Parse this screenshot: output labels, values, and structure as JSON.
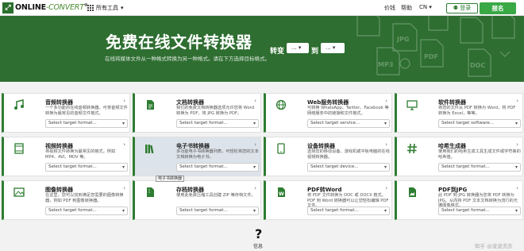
{
  "nav": {
    "logo_mark": "⤢",
    "logo_a": "ONLINE",
    "logo_b": "-CONVERT",
    "logo_c": "®",
    "all_tools": "所有工具",
    "pricing": "价钱",
    "help": "帮助",
    "lang": "CN",
    "login": "登录",
    "signup": "报名"
  },
  "hero": {
    "title": "免费在线文件转换器",
    "subtitle": "在线将媒体文件从一种格式转换为另一种格式。请在下方选择目标格式。",
    "convert_label": "转变",
    "to_label": "到",
    "from_value": "...",
    "to_value": "...",
    "deco_labels": [
      "JPG",
      "PDF",
      "DOC",
      "MP3"
    ]
  },
  "cards": [
    {
      "title": "音频转换器",
      "desc": "一个多功能的在线音频转换器。可将音频文件转换为最常见的音频文件格式。",
      "select": "Select target format...",
      "icon": "music-icon"
    },
    {
      "title": "文档转换器",
      "desc": "我们的免费文档转换器选项允许您将 Word 转换为 PDF、将 JPG 转换为 PDF。",
      "select": "Select target format...",
      "icon": "document-icon"
    },
    {
      "title": "Web服务转换器",
      "desc": "可转换 WhatsApp、Twitter、Facebook 等网络服务中的链接和文件格式。",
      "select": "Select target service...",
      "icon": "globe-icon"
    },
    {
      "title": "软件转换器",
      "desc": "将您的文件从 PDF 转换为 Word，将 PDF 转换为 Excel，等等。",
      "select": "Select target software...",
      "icon": "monitor-icon"
    },
    {
      "title": "视频转换器",
      "desc": "将视频文件转换为最常见的格式，例如 MP4、AVI、MOV 等。",
      "select": "Select target format...",
      "icon": "film-icon"
    },
    {
      "title": "电子书转换器",
      "desc": "多功能电子书转换器列表，可轻松将您的文本文档转换为电子书。",
      "select": "Select target format...",
      "icon": "books-icon"
    },
    {
      "title": "设备转换器",
      "desc": "选择您的移动设备、游戏机或平板电脑的在线视频转换器。",
      "select": "Select target device...",
      "icon": "tablet-icon"
    },
    {
      "title": "哈希生成器",
      "desc": "使用我们的哈希生成工具生成文件或字符串的哈希值。",
      "select": "Select target format...",
      "icon": "hash-icon"
    },
    {
      "title": "图像转换器",
      "desc": "在这里，您可以找到满足您需要的图像转换器，例如 PDF 到图像转换器。",
      "select": "Select target format...",
      "icon": "image-icon"
    },
    {
      "title": "存档转换器",
      "desc": "使用此免费压缩工具创建 ZIP 等存档文件。",
      "select": "Select target format...",
      "icon": "archive-icon"
    },
    {
      "title": "PDF转Word",
      "desc": "将 PDF 文件转换为 DOC 或 DOCX 格式。PDF 到 Word 转换器可以让您轻松编辑 PDF 文件。",
      "select": "Select target format...",
      "icon": "word-icon"
    },
    {
      "title": "PDF到JPG",
      "desc": "此 PDF 到 JPG 转换器为您将 PDF 转换为 JPG。从而将 PDF 文本文档转换为流行的光栅图像格式。",
      "select": "Select target format...",
      "icon": "pdf-image-icon"
    }
  ],
  "tooltip": "电子书转换器",
  "bottom": {
    "glyph": "?",
    "label": "信息"
  },
  "watermark": "知乎 @波波洗衣",
  "colors": {
    "brand_green": "#2e6e31",
    "accent_green": "#39a845"
  }
}
